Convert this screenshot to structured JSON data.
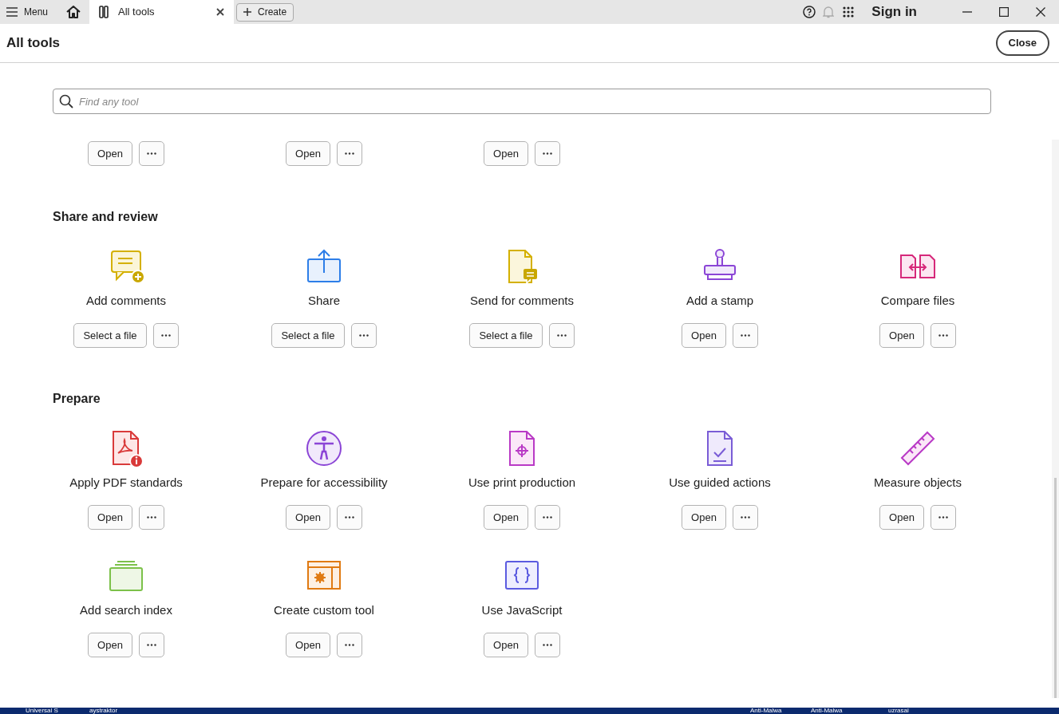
{
  "titlebar": {
    "menu": "Menu",
    "tab": {
      "label": "All tools",
      "selected": true
    },
    "create": "Create",
    "sign_in": "Sign in"
  },
  "header": {
    "title": "All tools",
    "close": "Close"
  },
  "search": {
    "placeholder": "Find any tool"
  },
  "top_row": [
    {
      "action": "Open"
    },
    {
      "action": "Open"
    },
    {
      "action": "Open"
    }
  ],
  "sections": [
    {
      "title": "Share and review",
      "tools": [
        {
          "name": "Add comments",
          "action": "Select a file",
          "kind": "comment"
        },
        {
          "name": "Share",
          "action": "Select a file",
          "kind": "share"
        },
        {
          "name": "Send for comments",
          "action": "Select a file",
          "kind": "send"
        },
        {
          "name": "Add a stamp",
          "action": "Open",
          "kind": "stamp"
        },
        {
          "name": "Compare files",
          "action": "Open",
          "kind": "compare"
        }
      ]
    },
    {
      "title": "Prepare",
      "tools": [
        {
          "name": "Apply PDF standards",
          "action": "Open",
          "kind": "pdfstd"
        },
        {
          "name": "Prepare for accessibility",
          "action": "Open",
          "kind": "access"
        },
        {
          "name": "Use print production",
          "action": "Open",
          "kind": "print"
        },
        {
          "name": "Use guided actions",
          "action": "Open",
          "kind": "guided"
        },
        {
          "name": "Measure objects",
          "action": "Open",
          "kind": "measure"
        },
        {
          "name": "Add search index",
          "action": "Open",
          "kind": "index"
        },
        {
          "name": "Create custom tool",
          "action": "Open",
          "kind": "custom"
        },
        {
          "name": "Use JavaScript",
          "action": "Open",
          "kind": "js"
        }
      ]
    }
  ],
  "taskbar": [
    {
      "label": "Universal S"
    },
    {
      "label": "aystraktor"
    },
    {
      "label": "Anti-Malwa"
    },
    {
      "label": "Anti-Malwa"
    },
    {
      "label": "uzrasai"
    }
  ]
}
